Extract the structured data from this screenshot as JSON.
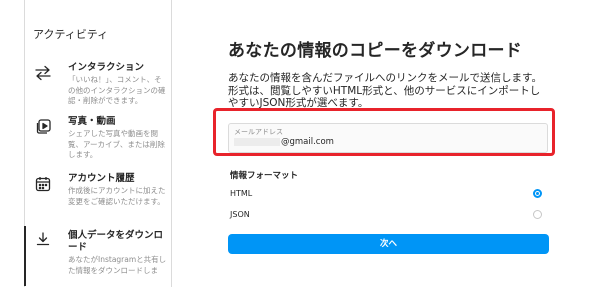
{
  "sidebar": {
    "title": "アクティビティ",
    "items": [
      {
        "icon": "swap-arrows-icon",
        "label": "インタラクション",
        "desc": "「いいね！」、コメント、その他のインタラクションの確認・削除ができます。"
      },
      {
        "icon": "photo-video-icon",
        "label": "写真・動画",
        "desc": "シェアした写真や動画を閲覧、アーカイブ、または削除します。"
      },
      {
        "icon": "calendar-icon",
        "label": "アカウント履歴",
        "desc": "作成後にアカウントに加えた変更をご確認いただけます。"
      },
      {
        "icon": "download-icon",
        "label": "個人データをダウンロード",
        "desc": "あなたがInstagramと共有した情報をダウンロードしま"
      }
    ]
  },
  "main": {
    "title": "あなたの情報のコピーをダウンロード",
    "intro": "あなたの情報を含んだファイルへのリンクをメールで送信します。形式は、閲覧しやすいHTML形式と、他のサービスにインポートしやすいJSON形式が選べます。",
    "email": {
      "label": "メールアドレス",
      "value": "@gmail.com"
    },
    "format": {
      "title": "情報フォーマット",
      "options": [
        {
          "label": "HTML",
          "selected": true
        },
        {
          "label": "JSON",
          "selected": false
        }
      ]
    },
    "next_label": "次へ"
  },
  "colors": {
    "accent": "#0095f6",
    "highlight": "#e8232b",
    "text": "#262626",
    "muted": "#8e8e8e"
  }
}
